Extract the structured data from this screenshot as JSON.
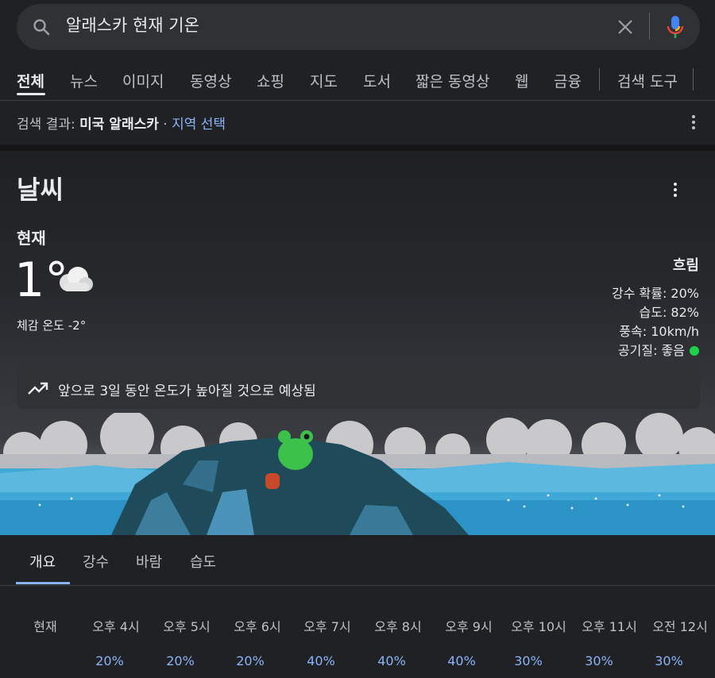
{
  "search": {
    "query": "알래스카 현재 기온"
  },
  "tabs": [
    "전체",
    "뉴스",
    "이미지",
    "동영상",
    "쇼핑",
    "지도",
    "도서",
    "짧은 동영상",
    "웹",
    "금융",
    "검색 도구"
  ],
  "region": {
    "prefix": "검색 결과:",
    "location": "미국 알래스카",
    "dot": " · ",
    "link": "지역 선택"
  },
  "weather": {
    "title": "날씨",
    "now_label": "현재",
    "temperature": "1°",
    "feels_like": "체감 온도 -2°",
    "condition": "흐림",
    "precip": "강수 확률: 20%",
    "humidity": "습도: 82%",
    "wind": "풍속: 10km/h",
    "air_quality": "공기질: 좋음",
    "trend": "앞으로 3일 동안 온도가 높아질 것으로 예상됨",
    "air_quality_color": "#1fd14a"
  },
  "subtabs": [
    "개요",
    "강수",
    "바람",
    "습도"
  ],
  "hourly": {
    "labels": [
      "현재",
      "오후 4시",
      "오후 5시",
      "오후 6시",
      "오후 7시",
      "오후 8시",
      "오후 9시",
      "오후 10시",
      "오후 11시",
      "오전 12시"
    ],
    "precip": [
      "20%",
      "20%",
      "20%",
      "40%",
      "40%",
      "40%",
      "30%",
      "30%",
      "30%"
    ]
  },
  "colors": {
    "background": "#202124",
    "accent": "#8ab4f8"
  }
}
